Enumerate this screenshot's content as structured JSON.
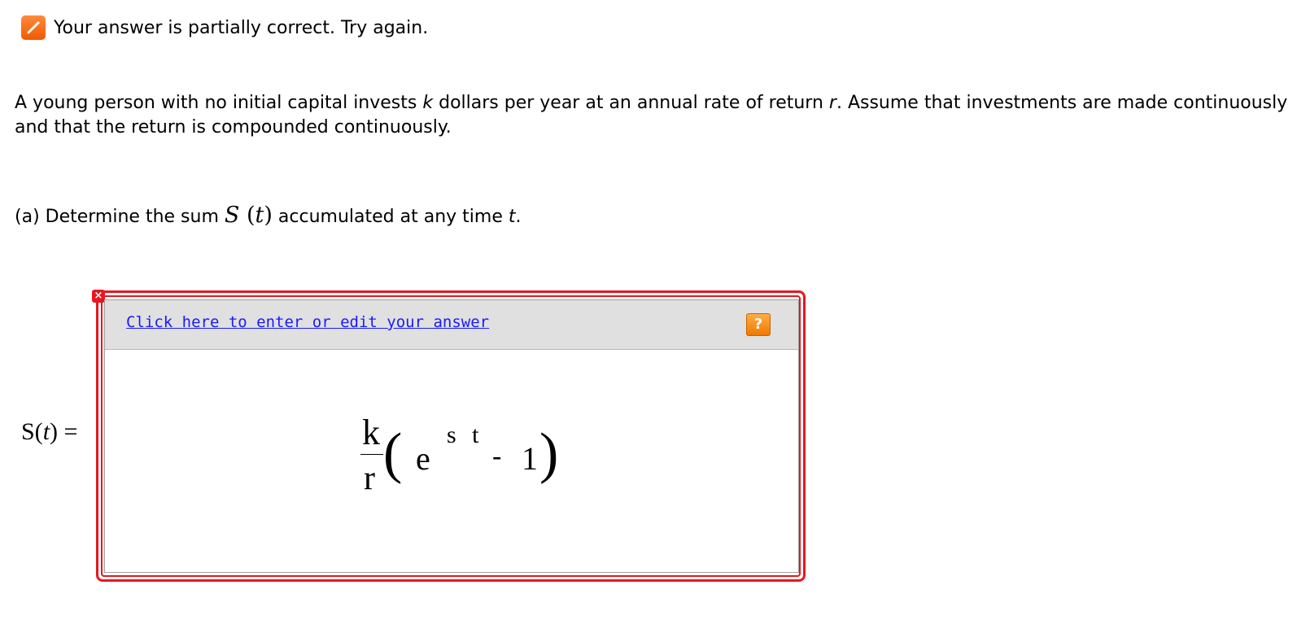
{
  "status": {
    "icon": "pencil-icon",
    "message": "Your answer is partially correct.  Try again."
  },
  "problem": {
    "part1": "A young person with no initial capital invests ",
    "var_k": "k",
    "part2": " dollars per year at an annual rate of return ",
    "var_r": "r",
    "part3": ". Assume that investments are made continuously and that the return is compounded continuously."
  },
  "part_a": {
    "prefix": "(a) Determine the sum ",
    "func": "S",
    "arg": "t",
    "middle": " accumulated at any time ",
    "var_t": "t",
    "end": "."
  },
  "answer": {
    "lhs_func": "S(",
    "lhs_var": "t",
    "lhs_end": ") =",
    "edit_link": "Click here to enter or edit your answer",
    "help_label": "?",
    "error_mark": "×",
    "expression": {
      "numerator": "k",
      "denominator": "r",
      "left_paren": "(",
      "base": "e",
      "exponent": "s t",
      "operator": "-",
      "constant": "1",
      "right_paren": ")"
    }
  },
  "colors": {
    "error": "#e8171d",
    "link": "#1a1aff",
    "accent": "#f07800"
  }
}
